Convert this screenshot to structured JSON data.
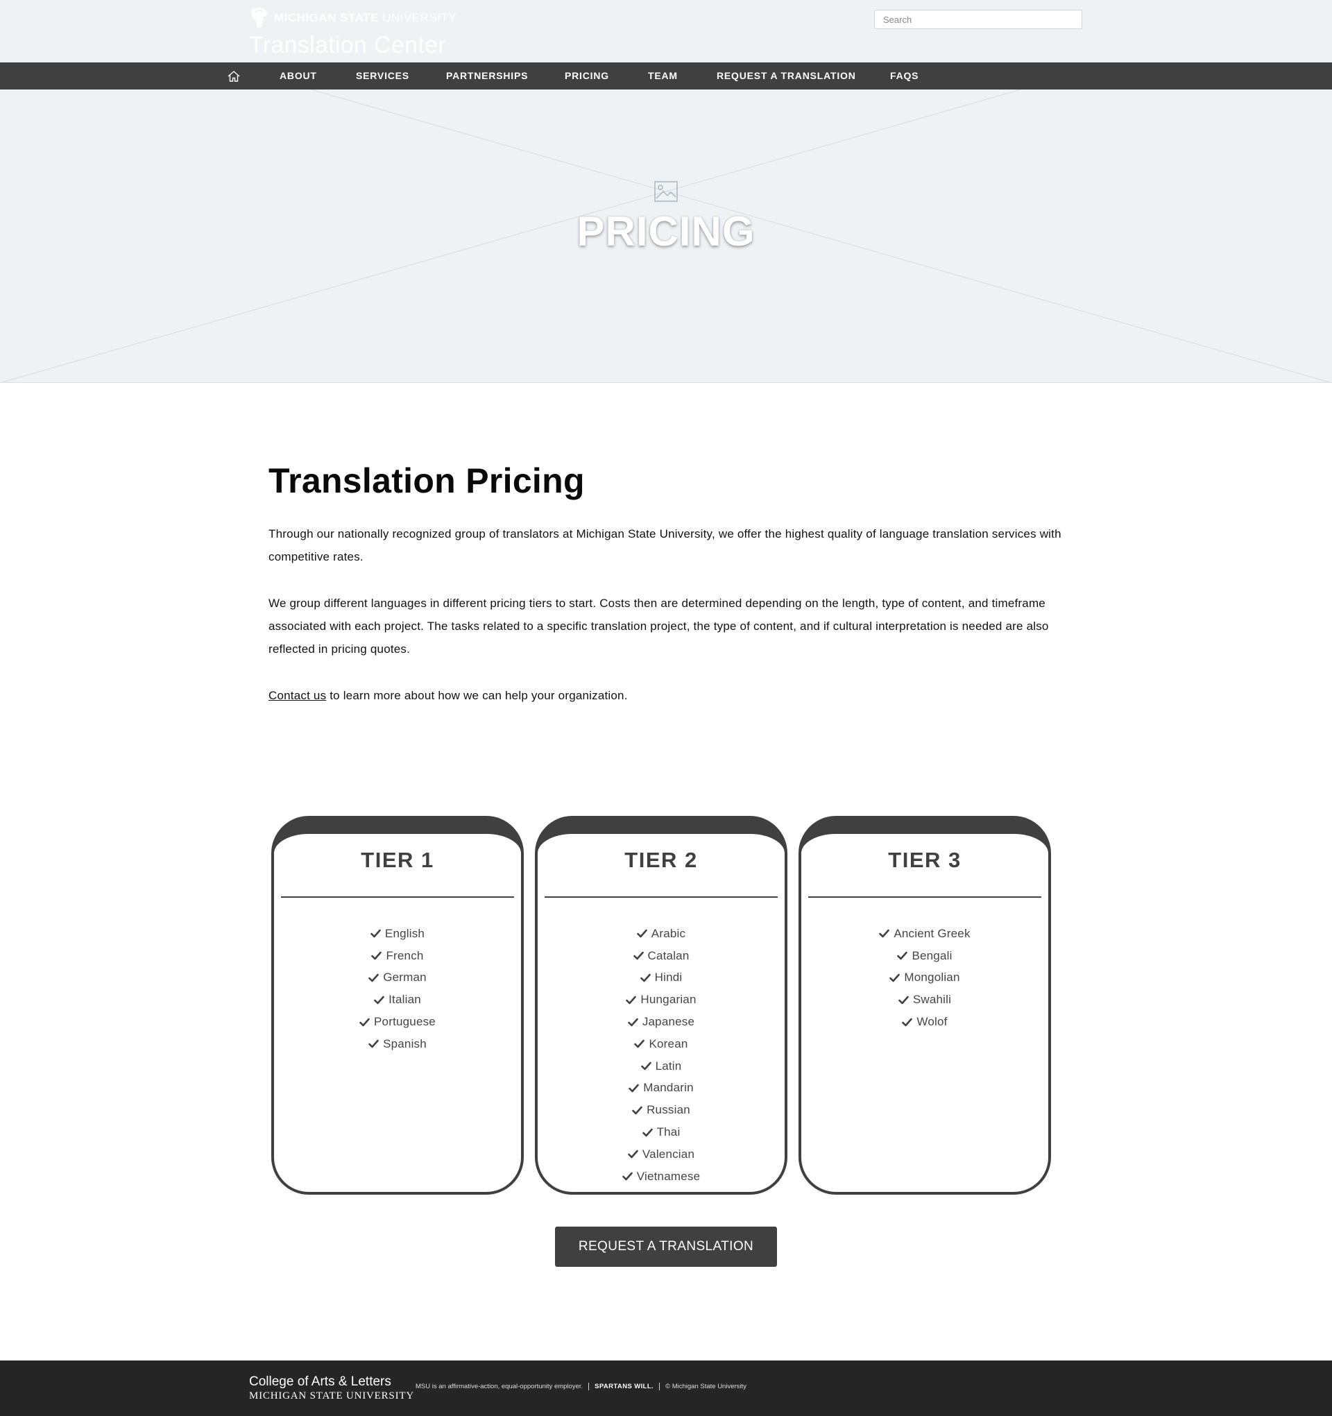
{
  "header": {
    "university_bold": "MICHIGAN STATE",
    "university_light": "UNIVERSITY",
    "center_name": "Translation Center",
    "search_placeholder": "Search"
  },
  "nav": {
    "items": [
      {
        "label": "ABOUT"
      },
      {
        "label": "SERVICES"
      },
      {
        "label": "PARTNERSHIPS"
      },
      {
        "label": "PRICING"
      },
      {
        "label": "TEAM"
      },
      {
        "label": "REQUEST A TRANSLATION"
      },
      {
        "label": "FAQS"
      }
    ]
  },
  "hero": {
    "title": "PRICING"
  },
  "content": {
    "title": "Translation Pricing",
    "para1": "Through our nationally recognized group of translators at Michigan State University, we offer the highest quality of language translation services with competitive rates.",
    "para2": "We group different languages in different pricing tiers to start. Costs then are determined depending on the length, type of content, and timeframe associated with each project. The tasks related to a specific translation project, the type of content, and if cultural interpretation is needed are also reflected in pricing quotes.",
    "contact_link": "Contact us",
    "para3_rest": " to learn more about how we can help your organization."
  },
  "tiers": [
    {
      "title": "TIER 1",
      "languages": [
        "English",
        "French",
        "German",
        "Italian",
        "Portuguese",
        "Spanish"
      ]
    },
    {
      "title": "TIER 2",
      "languages": [
        "Arabic",
        "Catalan",
        "Hindi",
        "Hungarian",
        "Japanese",
        "Korean",
        "Latin",
        "Mandarin",
        "Russian",
        "Thai",
        "Valencian",
        "Vietnamese"
      ]
    },
    {
      "title": "TIER 3",
      "languages": [
        "Ancient Greek",
        "Bengali",
        "Mongolian",
        "Swahili",
        "Wolof"
      ]
    }
  ],
  "cta": {
    "label": "REQUEST A TRANSLATION"
  },
  "footer": {
    "college": "College of Arts & Letters",
    "msu": "MICHIGAN STATE UNIVERSITY",
    "eeo": "MSU is an affirmative-action, equal-opportunity employer.",
    "spartans": "SPARTANS WILL.",
    "copyright": "© Michigan State University"
  }
}
